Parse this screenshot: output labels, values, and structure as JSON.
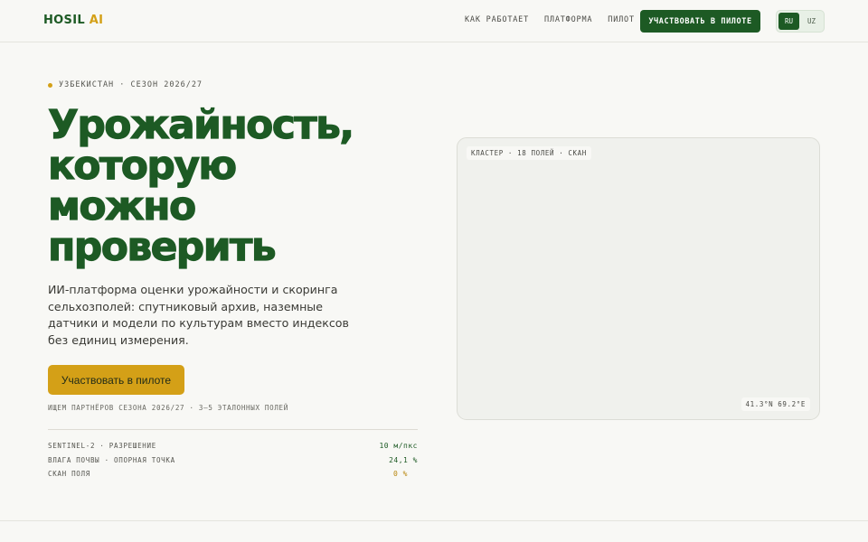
{
  "header": {
    "logo_main": "HOSIL",
    "logo_ai": "AI",
    "nav": [
      "КАК РАБОТАЕТ",
      "ПЛАТФОРМА",
      "ПИЛОТ"
    ],
    "cta_label": "УЧАСТВОВАТЬ В ПИЛОТЕ",
    "languages": [
      "RU",
      "UZ"
    ],
    "active_language": "RU"
  },
  "hero": {
    "eyebrow": "УЗБЕКИСТАН · СЕЗОН 2026/27",
    "headline": [
      "Урожайность,",
      "которую",
      "можно",
      "проверить"
    ],
    "lead": "ИИ-платформа оценки урожайности и скоринга сельхозполей: спутниковый архив, наземные датчики и модели по культурам вместо индексов без единиц измерения.",
    "cta_label": "Участвовать в пилоте",
    "note": "ИЩЕМ ПАРТНЁРОВ СЕЗОНА 2026/27 · 3–5 ЭТАЛОННЫХ ПОЛЕЙ"
  },
  "stats": [
    {
      "label": "SENTINEL-2 · РАЗРЕШЕНИЕ",
      "value": "10 м/пкс"
    },
    {
      "label": "ВЛАГА ПОЧВЫ · ОПОРНАЯ ТОЧКА",
      "value": "24,1 %"
    },
    {
      "label": "СКАН ПОЛЯ",
      "value": "0 %"
    }
  ],
  "panel": {
    "top_tag": "КЛАСТЕР · 18 ПОЛЕЙ · СКАН",
    "coords": "41.3°N 69.2°E"
  },
  "colors": {
    "brand_green": "#1d5a24",
    "accent_gold": "#d4a017",
    "background": "#f8f8f5"
  }
}
